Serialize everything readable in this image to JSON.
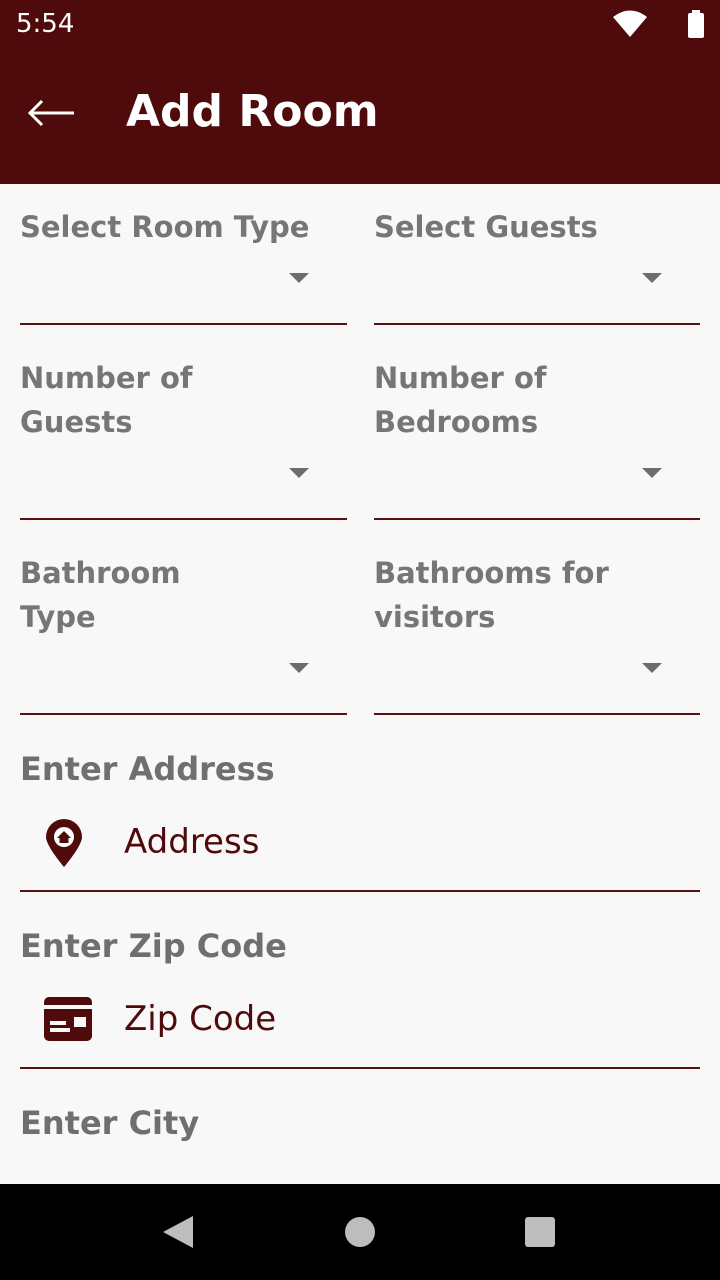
{
  "status_bar": {
    "time": "5:54",
    "icons": [
      "wifi-icon",
      "battery-icon"
    ]
  },
  "app_bar": {
    "back_icon": "arrow-left-icon",
    "title": "Add Room"
  },
  "dropdowns": [
    {
      "label": "Select Room Type",
      "value": ""
    },
    {
      "label": "Select Guests",
      "value": ""
    },
    {
      "label": "Number of Guests",
      "value": ""
    },
    {
      "label": "Number of Bedrooms",
      "value": ""
    },
    {
      "label": "Bathroom Type",
      "value": ""
    },
    {
      "label": "Bathrooms for visitors",
      "value": ""
    }
  ],
  "address": {
    "label": "Enter Address",
    "icon": "home-location-icon",
    "placeholder": "Address",
    "value": ""
  },
  "zip": {
    "label": "Enter Zip Code",
    "icon": "id-card-icon",
    "placeholder": "Zip Code",
    "value": ""
  },
  "city": {
    "label": "Enter City"
  },
  "nav_bar": {
    "icons": [
      "nav-back-icon",
      "nav-home-icon",
      "nav-recents-icon"
    ]
  },
  "colors": {
    "primary": "#4f0a0c",
    "label_gray": "#767676",
    "background": "#f8f8f8"
  }
}
